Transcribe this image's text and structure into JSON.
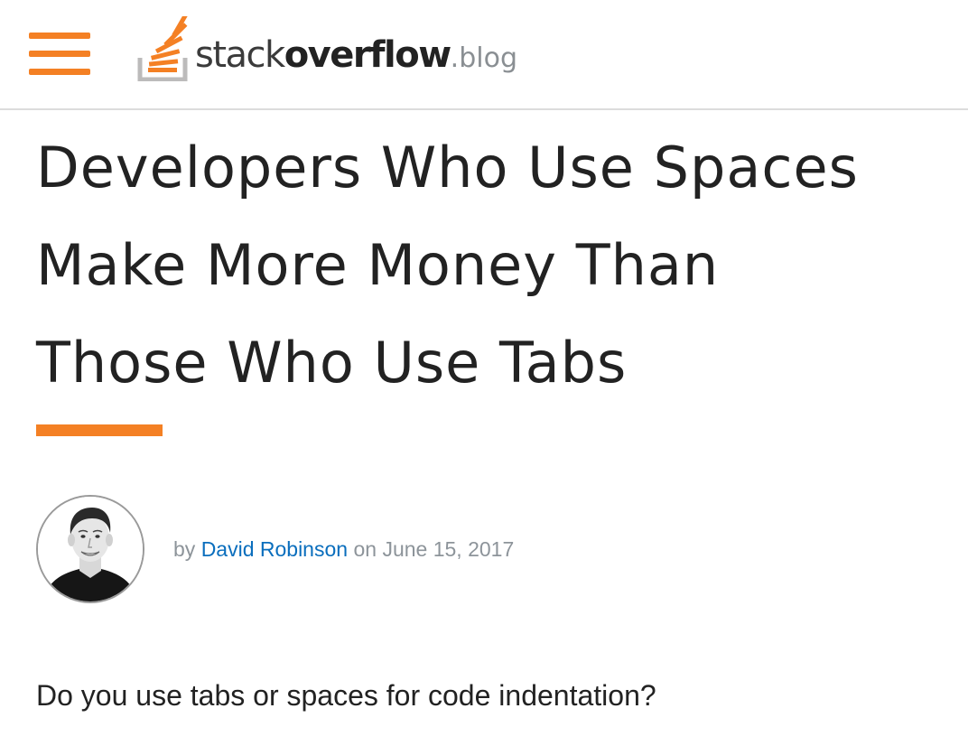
{
  "header": {
    "menu_icon": "hamburger-menu-icon",
    "logo": {
      "icon": "stackoverflow-logo-icon",
      "word1": "stack",
      "word2": "overflow",
      "word3": ".blog"
    }
  },
  "article": {
    "title_lines": [
      "Developers Who Use Spaces",
      "Make More Money Than",
      "Those Who Use Tabs"
    ],
    "byline": {
      "prefix": "by",
      "author": "David Robinson",
      "connector": "on",
      "date": "June 15, 2017"
    },
    "intro": "Do you use tabs or spaces for code indentation?"
  },
  "colors": {
    "accent": "#f48024",
    "link": "#0a6ebd",
    "text": "#222222",
    "muted": "#8d949a"
  }
}
